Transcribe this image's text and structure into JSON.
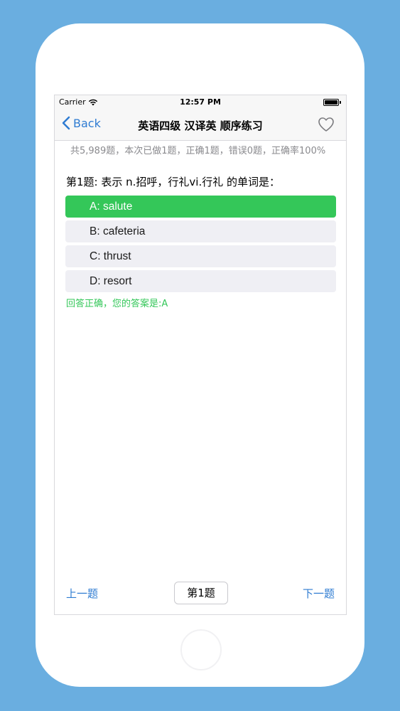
{
  "status_bar": {
    "carrier": "Carrier",
    "time": "12:57 PM"
  },
  "nav": {
    "back_label": "Back",
    "title": "英语四级 汉译英 顺序练习",
    "favorite_icon": "heart-icon"
  },
  "stats": {
    "text": "共5,989题，本次已做1题，正确1题，错误0题，正确率100%"
  },
  "question": {
    "text": "第1题: 表示 n.招呼，行礼vi.行礼 的单词是："
  },
  "options": [
    {
      "label": "A: salute",
      "state": "correct"
    },
    {
      "label": "B: cafeteria",
      "state": "normal"
    },
    {
      "label": "C: thrust",
      "state": "normal"
    },
    {
      "label": "D: resort",
      "state": "normal"
    }
  ],
  "result": {
    "text": "回答正确，您的答案是:A"
  },
  "footer": {
    "prev_label": "上一题",
    "page_label": "第1题",
    "next_label": "下一题"
  },
  "colors": {
    "background": "#6aaee0",
    "accent": "#2f7cd2",
    "correct": "#34c759",
    "option_bg": "#efeff4"
  }
}
